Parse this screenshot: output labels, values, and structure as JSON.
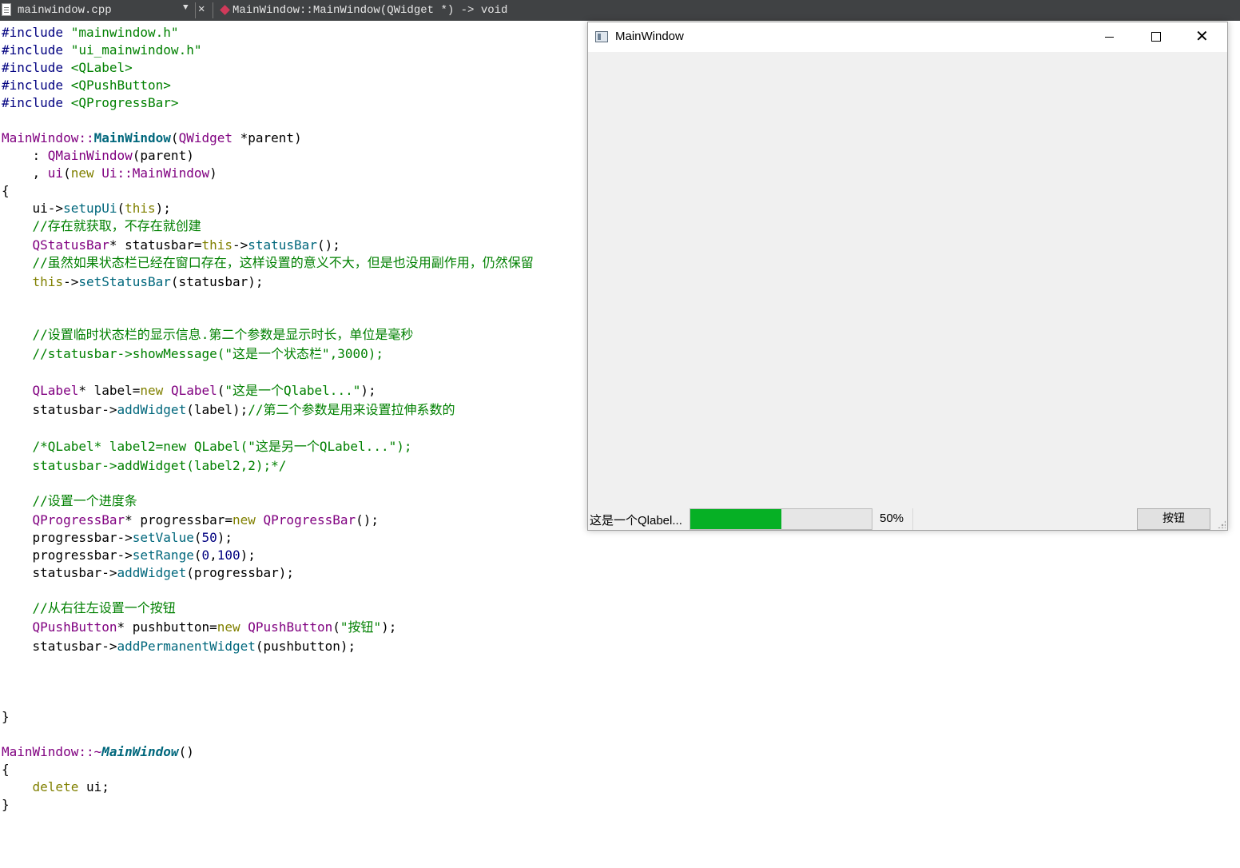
{
  "editor": {
    "file_name": "mainwindow.cpp",
    "dropdown_icon": "chevron-down-icon",
    "close_glyph": "✕",
    "function_signature": "MainWindow::MainWindow(QWidget *) -> void"
  },
  "code": {
    "l1a": "#include",
    "l1b": "\"mainwindow.h\"",
    "l2a": "#include",
    "l2b": "\"ui_mainwindow.h\"",
    "l3a": "#include",
    "l3b": "<QLabel>",
    "l4a": "#include",
    "l4b": "<QPushButton>",
    "l5a": "#include",
    "l5b": "<QProgressBar>",
    "ctor_class": "MainWindow",
    "ctor_sep": "::",
    "ctor_name": "MainWindow",
    "ctor_paren": "(",
    "ctor_type": "QWidget",
    "ctor_arg": " *parent)",
    "init1a": "    : ",
    "init1b": "QMainWindow",
    "init1c": "(parent)",
    "init2a": "    , ",
    "init2b": "ui",
    "init2c": "(",
    "init2d": "new",
    "init2e": " ",
    "init2f": "Ui",
    "init2g": "::",
    "init2h": "MainWindow",
    "init2i": ")",
    "brace_open": "{",
    "s1a": "    ui->",
    "s1b": "setupUi",
    "s1c": "(",
    "s1d": "this",
    "s1e": ");",
    "c1": "    //存在就获取，不存在就创建",
    "s2a": "    ",
    "s2b": "QStatusBar",
    "s2c": "* statusbar=",
    "s2d": "this",
    "s2e": "->",
    "s2f": "statusBar",
    "s2g": "();",
    "c2": "    //虽然如果状态栏已经在窗口存在，这样设置的意义不大，但是也没用副作用，仍然保留",
    "s3a": "    ",
    "s3b": "this",
    "s3c": "->",
    "s3d": "setStatusBar",
    "s3e": "(statusbar);",
    "c3": "    //设置临时状态栏的显示信息.第二个参数是显示时长，单位是毫秒",
    "c4": "    //statusbar->showMessage(\"这是一个状态栏\",3000);",
    "s4a": "    ",
    "s4b": "QLabel",
    "s4c": "* label=",
    "s4d": "new",
    "s4e": " ",
    "s4f": "QLabel",
    "s4g": "(",
    "s4h": "\"这是一个Qlabel...\"",
    "s4i": ");",
    "s5a": "    statusbar->",
    "s5b": "addWidget",
    "s5c": "(label);",
    "s5d": "//第二个参数是用来设置拉伸系数的",
    "c5": "    /*QLabel* label2=new QLabel(\"这是另一个QLabel...\");",
    "c6": "    statusbar->addWidget(label2,2);*/",
    "c7": "    //设置一个进度条",
    "s6a": "    ",
    "s6b": "QProgressBar",
    "s6c": "* progressbar=",
    "s6d": "new",
    "s6e": " ",
    "s6f": "QProgressBar",
    "s6g": "();",
    "s7a": "    progressbar->",
    "s7b": "setValue",
    "s7c": "(",
    "s7d": "50",
    "s7e": ");",
    "s8a": "    progressbar->",
    "s8b": "setRange",
    "s8c": "(",
    "s8d": "0",
    "s8e": ",",
    "s8f": "100",
    "s8g": ");",
    "s9a": "    statusbar->",
    "s9b": "addWidget",
    "s9c": "(progressbar);",
    "c8": "    //从右往左设置一个按钮",
    "s10a": "    ",
    "s10b": "QPushButton",
    "s10c": "* pushbutton=",
    "s10d": "new",
    "s10e": " ",
    "s10f": "QPushButton",
    "s10g": "(",
    "s10h": "\"按钮\"",
    "s10i": ");",
    "s11a": "    statusbar->",
    "s11b": "addPermanentWidget",
    "s11c": "(pushbutton);",
    "brace_close": "}",
    "dtor_class": "MainWindow",
    "dtor_sep": "::~",
    "dtor_name": "MainWindow",
    "dtor_paren": "()",
    "d1a": "    ",
    "d1b": "delete",
    "d1c": " ui;"
  },
  "window": {
    "title": "MainWindow",
    "app_icon": "window-app-icon",
    "status_label": "这是一个Qlabel...",
    "progress_value": 50,
    "progress_text": "50%",
    "button_label": "按钮",
    "progress_color": "#06b025"
  }
}
